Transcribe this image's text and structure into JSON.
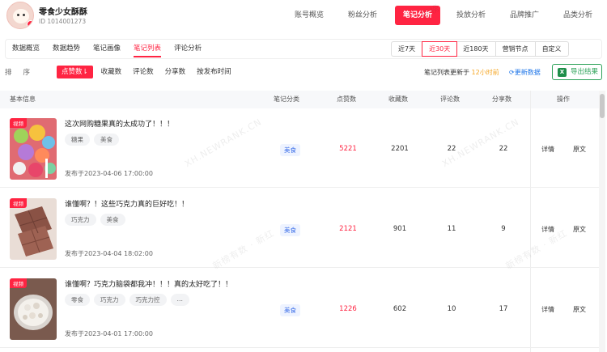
{
  "account": {
    "name": "零食少女酥酥",
    "id": "ID 1014001273"
  },
  "topnav": [
    {
      "label": "账号概览",
      "active": false
    },
    {
      "label": "粉丝分析",
      "active": false
    },
    {
      "label": "笔记分析",
      "active": true
    },
    {
      "label": "投放分析",
      "active": false
    },
    {
      "label": "品牌推广",
      "active": false
    },
    {
      "label": "品类分析",
      "active": false
    }
  ],
  "subtabs": [
    {
      "label": "数据概览",
      "active": false
    },
    {
      "label": "数据趋势",
      "active": false
    },
    {
      "label": "笔记画像",
      "active": false
    },
    {
      "label": "笔记列表",
      "active": true
    },
    {
      "label": "评论分析",
      "active": false
    }
  ],
  "ranges": [
    {
      "label": "近7天",
      "active": false
    },
    {
      "label": "近30天",
      "active": true
    },
    {
      "label": "近180天",
      "active": false
    },
    {
      "label": "营销节点",
      "active": false
    },
    {
      "label": "自定义",
      "active": false
    }
  ],
  "sort": {
    "label": "排序",
    "options": [
      {
        "label": "点赞数⇂",
        "active": true
      },
      {
        "label": "收藏数",
        "active": false
      },
      {
        "label": "评论数",
        "active": false
      },
      {
        "label": "分享数",
        "active": false
      },
      {
        "label": "按发布时间",
        "active": false
      }
    ]
  },
  "update": {
    "prefix": "笔记列表更新于",
    "time": "12小时前",
    "refresh": "更新数据",
    "export": "导出结果"
  },
  "columns": {
    "info": "基本信息",
    "category": "笔记分类",
    "likes": "点赞数",
    "collects": "收藏数",
    "comments": "评论数",
    "shares": "分享数",
    "ops": "操作"
  },
  "rows": [
    {
      "badge": "视频",
      "title": "这次网购糖果真的太成功了！！！",
      "tags": [
        "糖果",
        "美食"
      ],
      "published": "发布于2023-04-06 17:00:00",
      "category": "美食",
      "likes": "5221",
      "collects": "2201",
      "comments": "22",
      "shares": "22",
      "detail": "详情",
      "original": "原文"
    },
    {
      "badge": "视频",
      "title": "谁懂啊？！这些巧克力真的巨好吃！！",
      "tags": [
        "巧克力",
        "美食"
      ],
      "published": "发布于2023-04-04 18:02:00",
      "category": "美食",
      "likes": "2121",
      "collects": "901",
      "comments": "11",
      "shares": "9",
      "detail": "详情",
      "original": "原文"
    },
    {
      "badge": "视频",
      "title": "谁懂啊？巧克力脑袋都我冲！！！真的太好吃了！！",
      "tags": [
        "零食",
        "巧克力",
        "巧克力控",
        "…"
      ],
      "published": "发布于2023-04-01 17:00:00",
      "category": "美食",
      "likes": "1226",
      "collects": "602",
      "comments": "10",
      "shares": "17",
      "detail": "详情",
      "original": "原文"
    }
  ],
  "watermarks": [
    "新榜",
    "XH.NEWRANK.CN",
    "新榜有数 · 新红"
  ]
}
